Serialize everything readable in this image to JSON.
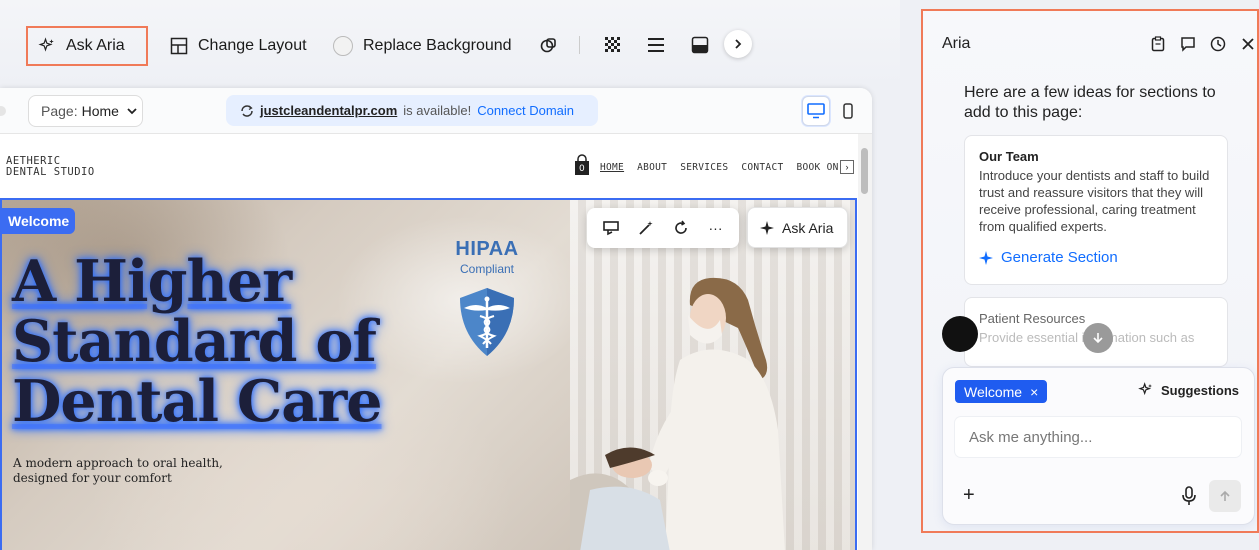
{
  "toolbar": {
    "ask_aria": "Ask Aria",
    "change_layout": "Change Layout",
    "replace_background": "Replace Background"
  },
  "browser": {
    "page_prefix": "Page:",
    "page_name": "Home",
    "domain": "justcleandentalpr.com",
    "domain_available": "is available!",
    "connect_domain": "Connect Domain"
  },
  "site": {
    "logo_line1": "AETHERIC",
    "logo_line2": "DENTAL STUDIO",
    "cart_count": "0",
    "nav": [
      "HOME",
      "ABOUT",
      "SERVICES",
      "CONTACT",
      "BOOK ON"
    ]
  },
  "hero": {
    "section_tag": "Welcome",
    "title_lines": [
      "A Higher",
      "Standard of",
      "Dental Care"
    ],
    "subtitle_line1": "A modern approach to oral health,",
    "subtitle_line2": "designed for your comfort",
    "hipaa_title": "HIPAA",
    "hipaa_sub": "Compliant",
    "ask_aria_float": "Ask Aria",
    "more": "···"
  },
  "aria": {
    "title": "Aria",
    "intro": "Here are a few ideas for sections to add to this page:",
    "cards": [
      {
        "title": "Our Team",
        "body": "Introduce your dentists and staff to build trust and reassure visitors that they will receive professional, caring treatment from qualified experts.",
        "action": "Generate Section"
      },
      {
        "title": "Patient Resources",
        "body": "Provide essential information such as"
      }
    ],
    "chip_label": "Welcome",
    "chip_close": "×",
    "suggestions": "Suggestions",
    "input_placeholder": "Ask me anything...",
    "plus": "+"
  },
  "colors": {
    "accent_blue": "#116dff",
    "highlight_orange": "#f07a58",
    "selection_blue": "#3b6cf2",
    "hipaa_blue": "#3a6fb5"
  }
}
